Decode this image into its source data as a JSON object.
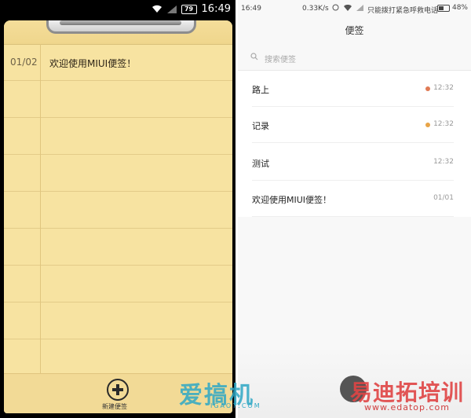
{
  "left": {
    "status_time": "16:49",
    "battery_label": "79",
    "note": {
      "date": "01/02",
      "text": "欢迎使用MIUI便签！"
    },
    "new_note_label": "新建便签"
  },
  "right": {
    "status": {
      "time": "16:49",
      "speed": "0.33K/s",
      "carrier": "只能拨打紧急呼救电话",
      "battery": "48%"
    },
    "title": "便签",
    "search_placeholder": "搜索便签",
    "notes": [
      {
        "title": "路上",
        "time": "12:32",
        "dot_color": "#e07a54"
      },
      {
        "title": "记录",
        "time": "12:32",
        "dot_color": "#e8a447"
      },
      {
        "title": "测试",
        "time": "12:32"
      },
      {
        "title": "欢迎使用MIUI便签！",
        "time": "01/01"
      }
    ]
  },
  "watermarks": {
    "left_main": "爱搞机",
    "left_sub": "IGAO7.COM",
    "right_main": "易迪拓培训",
    "right_sub": "www.edatop.com"
  }
}
